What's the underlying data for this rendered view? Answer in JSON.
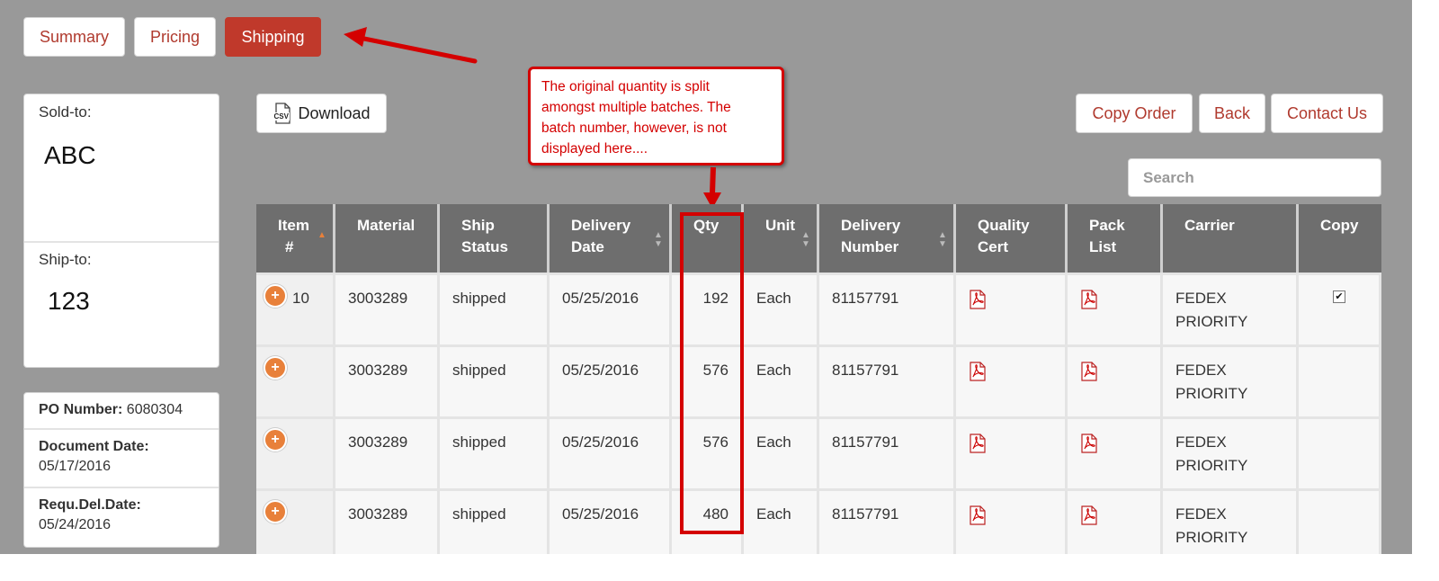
{
  "tabs": [
    "Summary",
    "Pricing",
    "Shipping"
  ],
  "active_tab": "Shipping",
  "sold_to": {
    "label": "Sold-to:",
    "value": "ABC"
  },
  "ship_to": {
    "label": "Ship-to:",
    "value": "123"
  },
  "info": [
    {
      "label": "PO Number:",
      "value": "6080304"
    },
    {
      "label": "Document Date:",
      "value": "05/17/2016"
    },
    {
      "label": "Requ.Del.Date:",
      "value": "05/24/2016"
    }
  ],
  "toolbar": {
    "download_label": "Download",
    "csv_icon_text": "CSV",
    "copy_order_label": "Copy Order",
    "back_label": "Back",
    "contact_label": "Contact Us"
  },
  "search": {
    "placeholder": "Search",
    "value": ""
  },
  "callout": {
    "lines": [
      "The original quantity is split",
      "amongst multiple batches.  The",
      "batch number, however, is not",
      "displayed here...."
    ]
  },
  "table": {
    "columns": [
      "Item #",
      "Material",
      "Ship Status",
      "Delivery Date",
      "Qty",
      "Unit",
      "Delivery Number",
      "Quality Cert",
      "Pack List",
      "Carrier",
      "Copy"
    ],
    "header_lines": [
      [
        "Item",
        "#"
      ],
      [
        "Material",
        ""
      ],
      [
        "Ship",
        "Status"
      ],
      [
        "Delivery",
        "Date"
      ],
      [
        "Qty",
        ""
      ],
      [
        "Unit",
        ""
      ],
      [
        "Delivery",
        "Number"
      ],
      [
        "Quality",
        "Cert"
      ],
      [
        "Pack",
        "List"
      ],
      [
        "Carrier",
        ""
      ],
      [
        "Copy",
        ""
      ]
    ],
    "rows": [
      {
        "item": "10",
        "material": "3003289",
        "status": "shipped",
        "date": "05/25/2016",
        "qty": "192",
        "unit": "Each",
        "delivery": "81157791",
        "carrier": [
          "FEDEX",
          "PRIORITY"
        ],
        "copy_checked": true
      },
      {
        "item": "",
        "material": "3003289",
        "status": "shipped",
        "date": "05/25/2016",
        "qty": "576",
        "unit": "Each",
        "delivery": "81157791",
        "carrier": [
          "FEDEX",
          "PRIORITY"
        ],
        "copy_checked": false
      },
      {
        "item": "",
        "material": "3003289",
        "status": "shipped",
        "date": "05/25/2016",
        "qty": "576",
        "unit": "Each",
        "delivery": "81157791",
        "carrier": [
          "FEDEX",
          "PRIORITY"
        ],
        "copy_checked": false
      },
      {
        "item": "",
        "material": "3003289",
        "status": "shipped",
        "date": "05/25/2016",
        "qty": "480",
        "unit": "Each",
        "delivery": "81157791",
        "carrier": [
          "FEDEX",
          "PRIORITY"
        ],
        "copy_checked": false
      }
    ]
  },
  "colors": {
    "accent": "#c0392b",
    "annotation": "#d40000",
    "sort_active": "#e8803a",
    "header_bg": "#6e6e6e",
    "page_bg": "#999999"
  }
}
